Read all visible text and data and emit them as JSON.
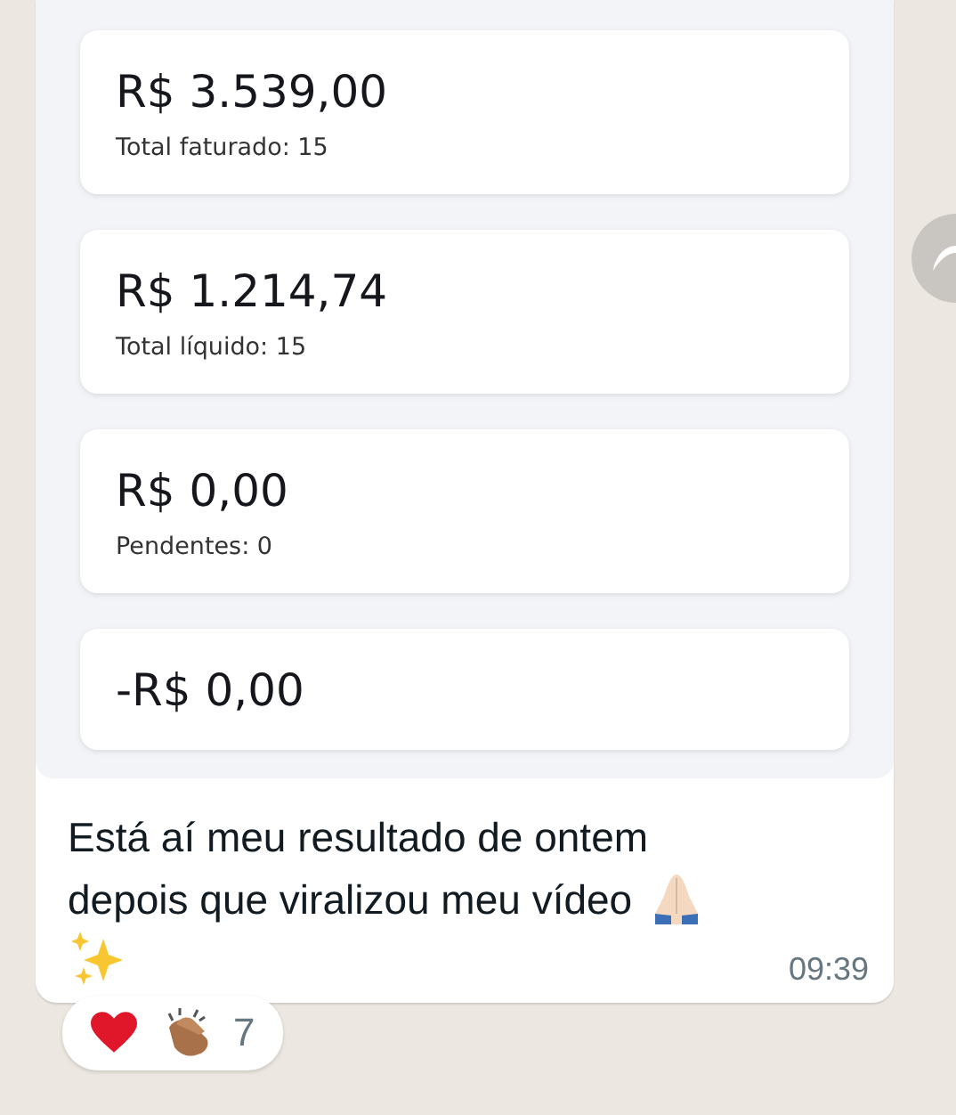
{
  "image_cards": [
    {
      "amount": "R$ 3.539,00",
      "label": "Total faturado: 15"
    },
    {
      "amount": "R$ 1.214,74",
      "label": "Total líquido: 15"
    },
    {
      "amount": "R$ 0,00",
      "label": "Pendentes: 0"
    },
    {
      "amount": "-R$ 0,00"
    }
  ],
  "message": {
    "lines": [
      "Está aí meu resultado de ontem",
      "depois que viralizou meu vídeo"
    ],
    "time": "09:39"
  },
  "reactions": {
    "count": "7"
  }
}
